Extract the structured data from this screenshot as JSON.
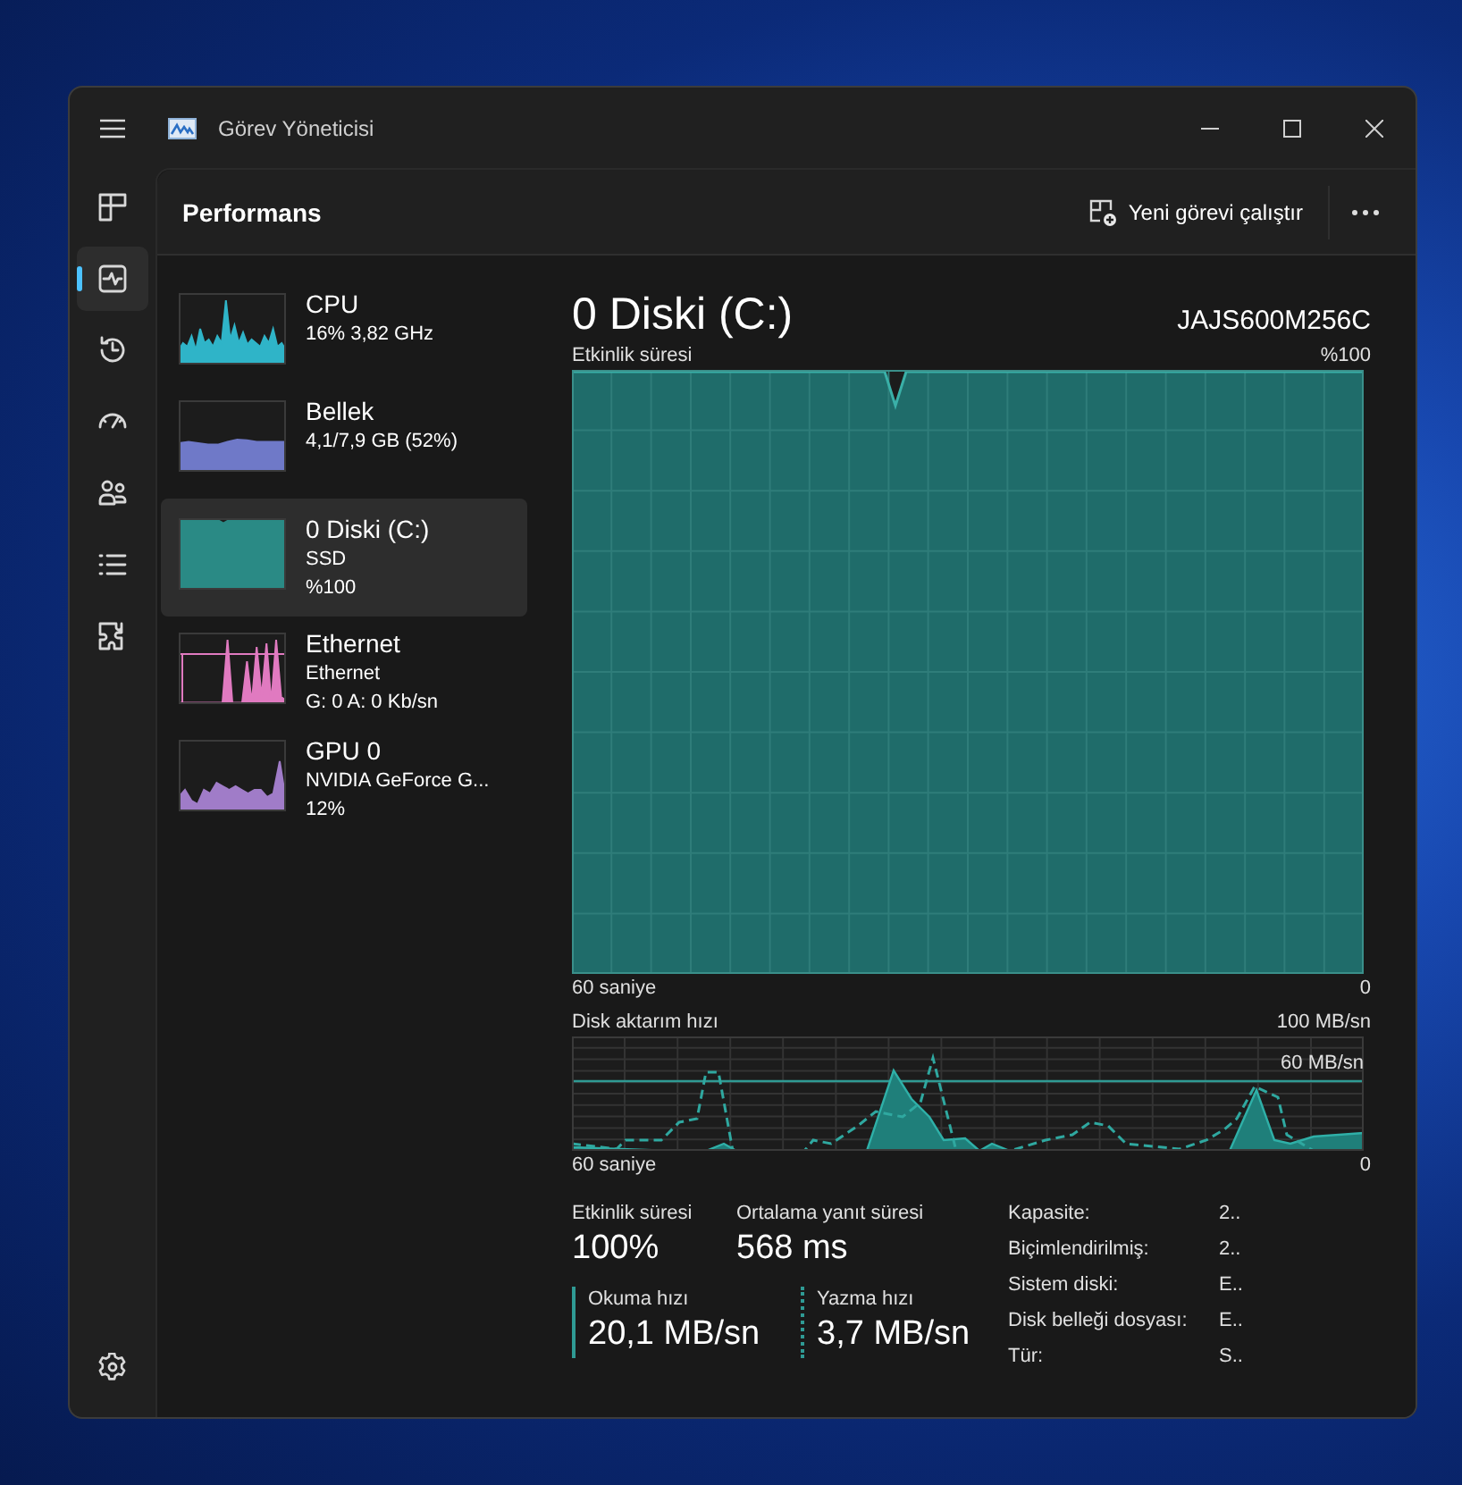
{
  "window": {
    "title": "Görev Yöneticisi"
  },
  "nav": {
    "items": [
      {
        "selected": false
      },
      {
        "selected": true
      },
      {
        "selected": false
      },
      {
        "selected": false
      },
      {
        "selected": false
      },
      {
        "selected": false
      },
      {
        "selected": false
      }
    ]
  },
  "header": {
    "title": "Performans",
    "action": "Yeni görevi çalıştır"
  },
  "devices": [
    {
      "name": "CPU",
      "lines": [
        "16%  3,82 GHz"
      ],
      "color": "#2fb4c8",
      "kind": "spiky",
      "selected": false
    },
    {
      "name": "Bellek",
      "lines": [
        "4,1/7,9 GB (52%)"
      ],
      "color": "#6f79c8",
      "kind": "flat",
      "selected": false
    },
    {
      "name": "0 Diski (C:)",
      "lines": [
        "SSD",
        "%100"
      ],
      "color": "#2a8a85",
      "kind": "full",
      "selected": true
    },
    {
      "name": "Ethernet",
      "lines": [
        "Ethernet",
        "G: 0 A: 0 Kb/sn"
      ],
      "color": "#e07ac0",
      "kind": "bars",
      "selected": false
    },
    {
      "name": "GPU 0",
      "lines": [
        "NVIDIA GeForce G...",
        "12%"
      ],
      "color": "#a07cc8",
      "kind": "low",
      "selected": false
    }
  ],
  "detail": {
    "title": "0 Diski (C:)",
    "model": "JAJS600M256C",
    "activity_chart": {
      "label": "Etkinlik süresi",
      "max": "%100",
      "time": "60 saniye",
      "min": "0"
    },
    "transfer_chart": {
      "label": "Disk aktarım hızı",
      "max": "100 MB/sn",
      "line_label": "60 MB/sn",
      "time": "60 saniye",
      "min": "0"
    },
    "stats": [
      {
        "label": "Etkinlik süresi",
        "value": "100%"
      },
      {
        "label": "Ortalama yanıt süresi",
        "value": "568 ms"
      }
    ],
    "rates": [
      {
        "label": "Okuma hızı",
        "value": "20,1 MB/sn",
        "kind": "solid"
      },
      {
        "label": "Yazma hızı",
        "value": "3,7 MB/sn",
        "kind": "dashed"
      }
    ],
    "properties": [
      {
        "label": "Kapasite:",
        "value": "2.."
      },
      {
        "label": "Biçimlendirilmiş:",
        "value": "2.."
      },
      {
        "label": "Sistem diski:",
        "value": "E.."
      },
      {
        "label": "Disk belleği dosyası:",
        "value": "E.."
      },
      {
        "label": "Tür:",
        "value": "S.."
      }
    ]
  }
}
